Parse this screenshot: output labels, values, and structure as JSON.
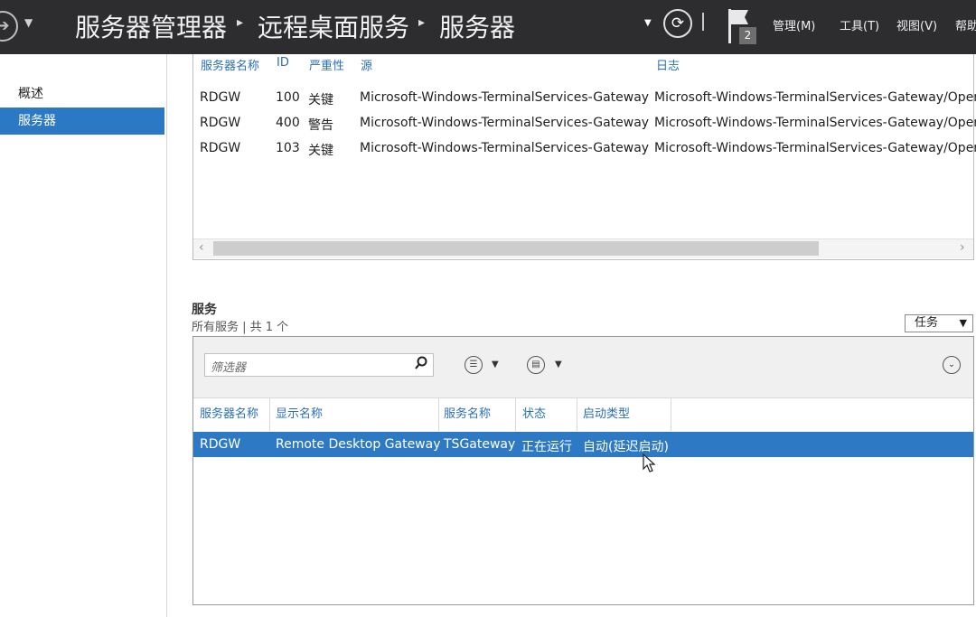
{
  "header": {
    "breadcrumb": [
      "服务器管理器",
      "远程桌面服务",
      "服务器"
    ],
    "notification_count": "2",
    "menus": [
      "管理(M)",
      "工具(T)",
      "视图(V)",
      "帮助"
    ]
  },
  "sidebar": {
    "items": [
      {
        "label": "概述",
        "active": false
      },
      {
        "label": "服务器",
        "active": true
      }
    ]
  },
  "events": {
    "columns": [
      "服务器名称",
      "ID",
      "严重性",
      "源",
      "日志"
    ],
    "rows": [
      [
        "RDGW",
        "100",
        "关键",
        "Microsoft-Windows-TerminalServices-Gateway",
        "Microsoft-Windows-TerminalServices-Gateway/Oper"
      ],
      [
        "RDGW",
        "400",
        "警告",
        "Microsoft-Windows-TerminalServices-Gateway",
        "Microsoft-Windows-TerminalServices-Gateway/Oper"
      ],
      [
        "RDGW",
        "103",
        "关键",
        "Microsoft-Windows-TerminalServices-Gateway",
        "Microsoft-Windows-TerminalServices-Gateway/Oper"
      ]
    ]
  },
  "services": {
    "title": "服务",
    "subtitle": "所有服务 | 共 1 个",
    "tasks_label": "任务",
    "filter_placeholder": "筛选器",
    "columns": [
      "服务器名称",
      "显示名称",
      "服务名称",
      "状态",
      "启动类型"
    ],
    "rows": [
      [
        "RDGW",
        "Remote Desktop Gateway",
        "TSGateway",
        "正在运行",
        "自动(延迟启动)"
      ]
    ]
  },
  "colors": {
    "topbar": "#2d2d30",
    "accent": "#2b78c5",
    "link": "#2b6fb5"
  }
}
